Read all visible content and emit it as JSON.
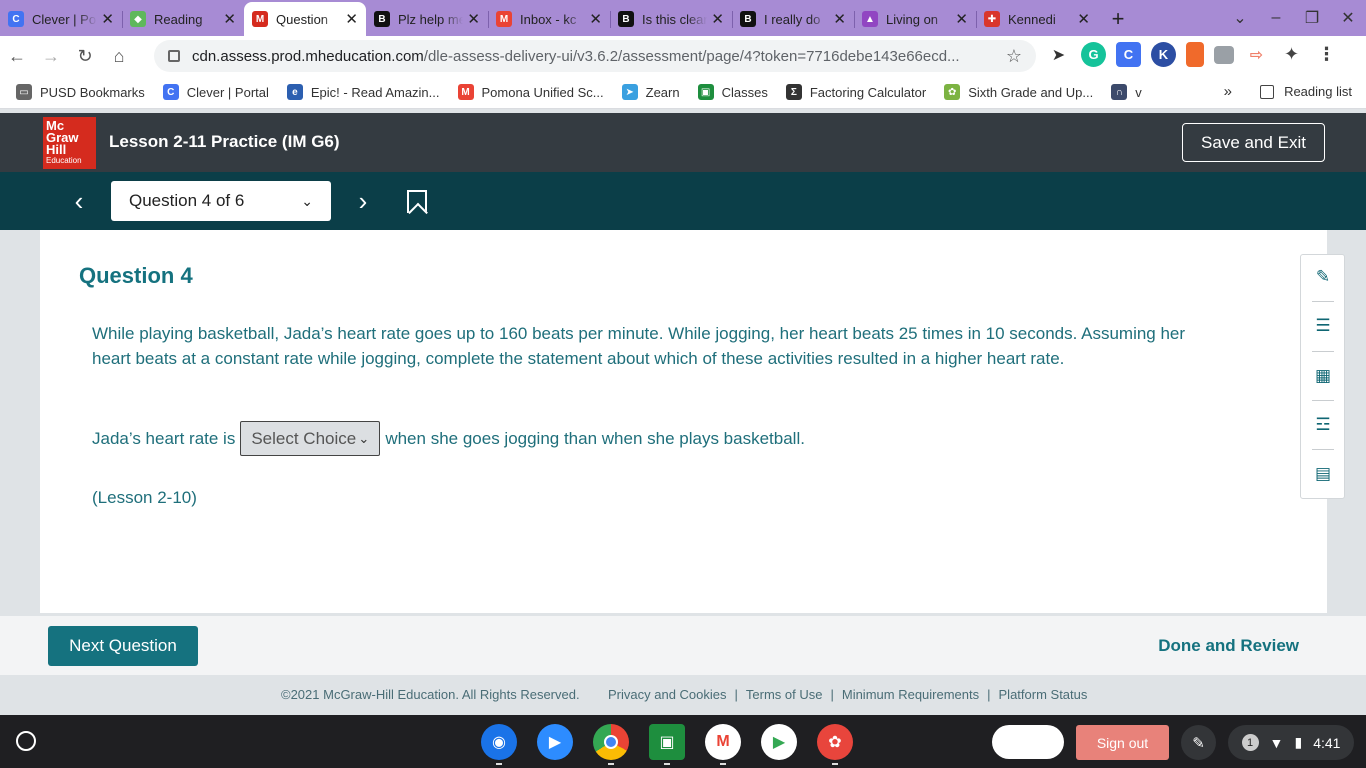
{
  "browser": {
    "tabs": [
      {
        "title": "Clever | Portal",
        "favicon": "C",
        "color": "#4273f2"
      },
      {
        "title": "Reading",
        "favicon": "◆",
        "color": "#5fb85c"
      },
      {
        "title": "Question",
        "favicon": "M",
        "color": "#d52b1e",
        "active": true
      },
      {
        "title": "Plz help me",
        "favicon": "B",
        "color": "#111111"
      },
      {
        "title": "Inbox - kc",
        "favicon": "M",
        "color": "#ea4335"
      },
      {
        "title": "Is this clear",
        "favicon": "B",
        "color": "#111111"
      },
      {
        "title": "I really do",
        "favicon": "B",
        "color": "#111111"
      },
      {
        "title": "Living on",
        "favicon": "▲",
        "color": "#9146c2"
      },
      {
        "title": "Kennedi",
        "favicon": "✚",
        "color": "#d9362c"
      }
    ],
    "url_host": "cdn.assess.prod.mheducation.com",
    "url_path": "/dle-assess-delivery-ui/v3.6.2/assessment/page/4?token=7716debe143e66ecd...",
    "bookmarks": [
      {
        "label": "PUSD Bookmarks",
        "icon": "▭",
        "color": "#666666"
      },
      {
        "label": "Clever | Portal",
        "icon": "C",
        "color": "#4273f2"
      },
      {
        "label": "Epic! - Read Amazin...",
        "icon": "e",
        "color": "#2c5fb0"
      },
      {
        "label": "Pomona Unified Sc...",
        "icon": "M",
        "color": "#ea4335"
      },
      {
        "label": "Zearn",
        "icon": "➤",
        "color": "#3aa0e0"
      },
      {
        "label": "Classes",
        "icon": "▣",
        "color": "#1e8e3e"
      },
      {
        "label": "Factoring Calculator",
        "icon": "Σ",
        "color": "#333333"
      },
      {
        "label": "Sixth Grade and Up...",
        "icon": "✿",
        "color": "#7cb342"
      },
      {
        "label": "v",
        "icon": "∩",
        "color": "#3c4a6b"
      }
    ],
    "bookmarks_more": "»",
    "reading_list": "Reading list"
  },
  "app": {
    "logo": {
      "line1": "Mc",
      "line2": "Graw",
      "line3": "Hill",
      "line4": "Education"
    },
    "lesson_title": "Lesson 2-11 Practice (IM G6)",
    "save_exit": "Save and Exit",
    "question_selector": "Question 4 of 6"
  },
  "question": {
    "heading": "Question 4",
    "body": "While playing basketball, Jada’s heart rate goes up to 160 beats per minute. While jogging, her heart beats 25 times in 10 seconds. Assuming her heart beats at a constant rate while jogging, complete the statement about which of these activities resulted in a higher heart rate.",
    "answer_prefix": "Jada’s heart rate is",
    "select_value": "Select Choice",
    "answer_suffix": "when she goes jogging than when she plays basketball.",
    "lesson_ref": "(Lesson 2-10)"
  },
  "footer": {
    "next_question": "Next Question",
    "done_review": "Done and Review",
    "copyright": "©2021 McGraw-Hill Education. All Rights Reserved.",
    "links": [
      "Privacy and Cookies",
      "Terms of Use",
      "Minimum Requirements",
      "Platform Status"
    ],
    "link_separator": "|"
  },
  "shelf": {
    "signout": "Sign out",
    "notification_count": "1",
    "time": "4:41"
  }
}
